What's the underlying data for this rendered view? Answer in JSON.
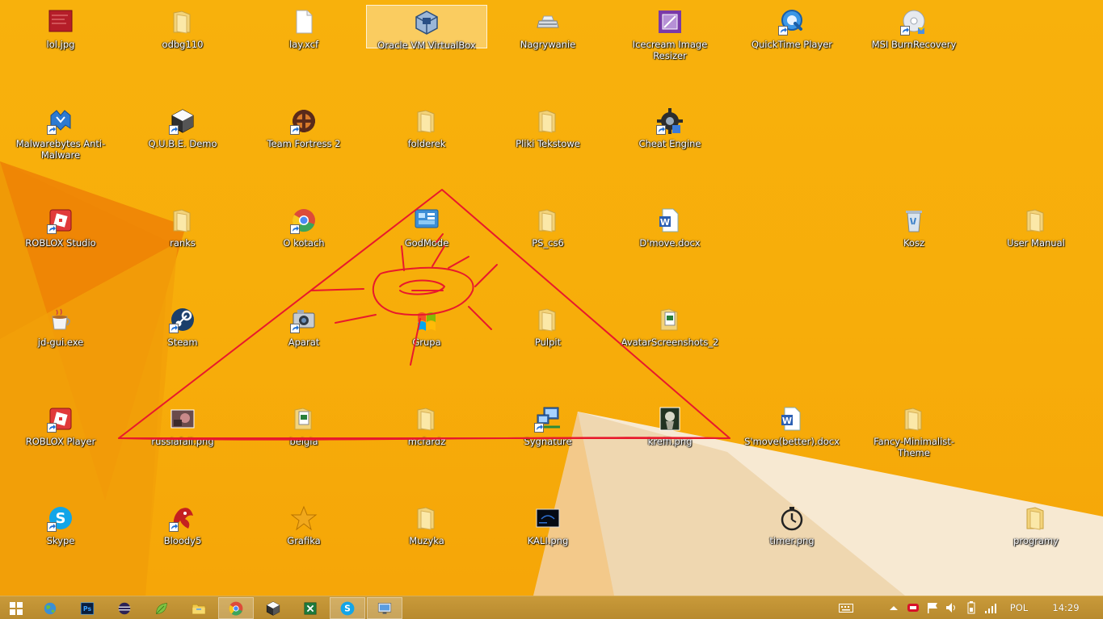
{
  "colors": {
    "wallpaper_base": "#f8b10c",
    "wallpaper_dark_orange": "#ee8a05",
    "wallpaper_cream": "#f6e8cf",
    "drawing_red": "#e8192c",
    "taskbar": "#c0922f"
  },
  "desktop_icons": [
    {
      "label": "lol.jpg",
      "kind": "image-red",
      "shortcut": false
    },
    {
      "label": "odbg110",
      "kind": "folder",
      "shortcut": false
    },
    {
      "label": "lay.xcf",
      "kind": "document",
      "shortcut": false
    },
    {
      "label": "Oracle VM VirtualBox",
      "kind": "virtualbox",
      "shortcut": false,
      "selected": true
    },
    {
      "label": "Nagrywanie",
      "kind": "drive",
      "shortcut": false
    },
    {
      "label": "Icecream Image Resizer",
      "kind": "resizer",
      "shortcut": false
    },
    {
      "label": "QuickTime Player",
      "kind": "quicktime",
      "shortcut": true
    },
    {
      "label": "MSI BurnRecovery",
      "kind": "disc",
      "shortcut": true
    },
    {
      "label": "Malwarebytes Anti-Malware",
      "kind": "malwarebytes",
      "shortcut": true
    },
    {
      "label": "Q.U.B.E. Demo",
      "kind": "cube",
      "shortcut": true
    },
    {
      "label": "Team Fortress 2",
      "kind": "tf2",
      "shortcut": true
    },
    {
      "label": "folderek",
      "kind": "folder",
      "shortcut": false
    },
    {
      "label": "Pliki Tekstowe",
      "kind": "folder",
      "shortcut": false
    },
    {
      "label": "Cheat Engine",
      "kind": "gear",
      "shortcut": true
    },
    {
      "label": "ROBLOX Studio",
      "kind": "roblox",
      "shortcut": true
    },
    {
      "label": "ranks",
      "kind": "folder",
      "shortcut": false
    },
    {
      "label": "O kotach",
      "kind": "chrome",
      "shortcut": true
    },
    {
      "label": "GodMode",
      "kind": "controlpanel",
      "shortcut": false
    },
    {
      "label": "PS_cs6",
      "kind": "folder",
      "shortcut": false
    },
    {
      "label": "D'move.docx",
      "kind": "word",
      "shortcut": false
    },
    {
      "label": "Kosz",
      "kind": "recycle",
      "shortcut": false
    },
    {
      "label": "User Manual",
      "kind": "folder",
      "shortcut": false
    },
    {
      "label": "jd-gui.exe",
      "kind": "coffee",
      "shortcut": false
    },
    {
      "label": "Steam",
      "kind": "steam",
      "shortcut": true
    },
    {
      "label": "Aparat",
      "kind": "camera",
      "shortcut": true
    },
    {
      "label": "Grupa",
      "kind": "windows-flag",
      "shortcut": false
    },
    {
      "label": "Pulpit",
      "kind": "folder",
      "shortcut": false
    },
    {
      "label": "AvatarScreenshots_2",
      "kind": "folder-docs",
      "shortcut": false
    },
    {
      "label": "ROBLOX Player",
      "kind": "roblox",
      "shortcut": true
    },
    {
      "label": "russiafail.png",
      "kind": "photo-dark",
      "shortcut": false
    },
    {
      "label": "belgia",
      "kind": "folder-docs",
      "shortcut": false
    },
    {
      "label": "mcfardz",
      "kind": "folder",
      "shortcut": false
    },
    {
      "label": "Sygnature",
      "kind": "network",
      "shortcut": true
    },
    {
      "label": "kreffi.png",
      "kind": "photo-green",
      "shortcut": false
    },
    {
      "label": "S'move(better).docx",
      "kind": "word",
      "shortcut": false
    },
    {
      "label": "Fancy-Minimalist-Theme",
      "kind": "folder",
      "shortcut": false
    },
    {
      "label": "Skype",
      "kind": "skype",
      "shortcut": true
    },
    {
      "label": "Bloody5",
      "kind": "bloody",
      "shortcut": true
    },
    {
      "label": "Grafika",
      "kind": "star",
      "shortcut": false
    },
    {
      "label": "Muzyka",
      "kind": "folder",
      "shortcut": false
    },
    {
      "label": "KALI.png",
      "kind": "photo-black",
      "shortcut": false
    },
    {
      "label": "timer.png",
      "kind": "timer",
      "shortcut": false
    },
    {
      "label": "programy",
      "kind": "folder",
      "shortcut": false
    }
  ],
  "taskbar": {
    "start_icon": "windows-start-icon",
    "pinned": [
      {
        "name": "world-app",
        "kind": "globe"
      },
      {
        "name": "photoshop",
        "kind": "ps",
        "text": "Ps"
      },
      {
        "name": "eclipse",
        "kind": "eclipse"
      },
      {
        "name": "leaf-app",
        "kind": "leaf"
      },
      {
        "name": "file-explorer",
        "kind": "explorer"
      },
      {
        "name": "chrome",
        "kind": "chrome",
        "active": true
      },
      {
        "name": "minecraft",
        "kind": "cube"
      },
      {
        "name": "excel-app",
        "kind": "excel"
      },
      {
        "name": "skype",
        "kind": "skype",
        "active": true
      },
      {
        "name": "remote-desktop",
        "kind": "monitor",
        "active": true
      }
    ],
    "tray": {
      "keyboard_icon": "keyboard-icon",
      "show_hidden_icon": "chevron-up-icon",
      "language": "POL",
      "time": "14:29"
    }
  }
}
